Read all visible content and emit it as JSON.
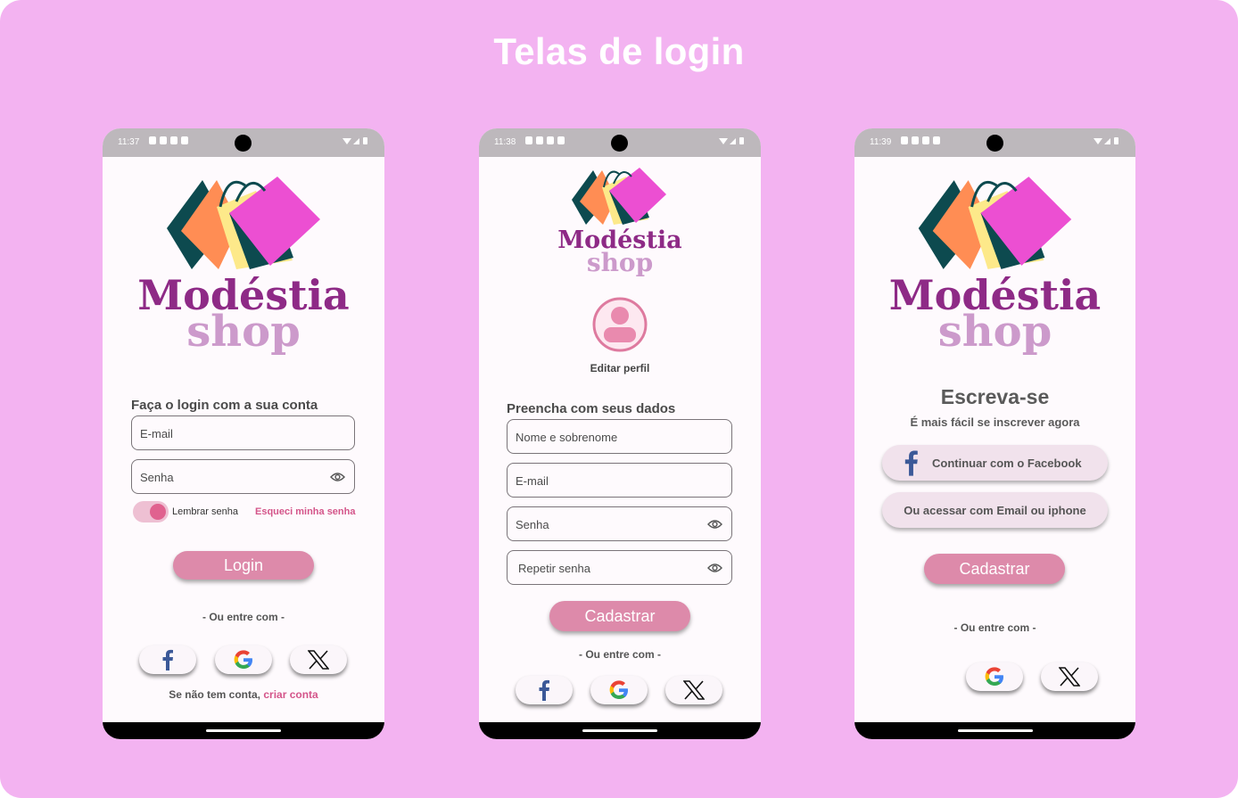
{
  "page": {
    "title": "Telas de login"
  },
  "brand": {
    "line1": "Modéstia",
    "line2": "shop"
  },
  "phone1": {
    "time": "11:37",
    "heading": "Faça o login com a sua conta",
    "email_placeholder": "E-mail",
    "password_placeholder": "Senha",
    "remember_label": "Lembrar senha",
    "forgot_link": "Esqueci minha senha",
    "login_button": "Login",
    "divider_text": "- Ou entre com -",
    "no_account_text": "Se não tem conta,",
    "create_account_link": "criar conta"
  },
  "phone2": {
    "time": "11:38",
    "edit_profile_label": "Editar perfil",
    "heading": "Preencha com seus dados",
    "name_placeholder": "Nome e sobrenome",
    "email_placeholder": "E-mail",
    "password_placeholder": "Senha",
    "repeat_password_placeholder": "Repetir senha",
    "register_button": "Cadastrar",
    "divider_text": "- Ou entre com -"
  },
  "phone3": {
    "time": "11:39",
    "title": "Escreva-se",
    "subtitle": "É mais fácil se inscrever agora",
    "facebook_button": "Continuar com o Facebook",
    "email_button": "Ou acessar com Email ou iphone",
    "register_button": "Cadastrar",
    "divider_text": "- Ou entre com -"
  },
  "colors": {
    "background": "#f3b3f1",
    "brand_purple": "#8e2a86",
    "brand_lilac": "#cc9acb",
    "button_pink": "#dd8aaa",
    "link_pink": "#d4558a"
  },
  "icons": [
    "facebook-icon",
    "google-icon",
    "x-icon",
    "eye-icon",
    "avatar-icon",
    "shopping-bags-logo"
  ]
}
